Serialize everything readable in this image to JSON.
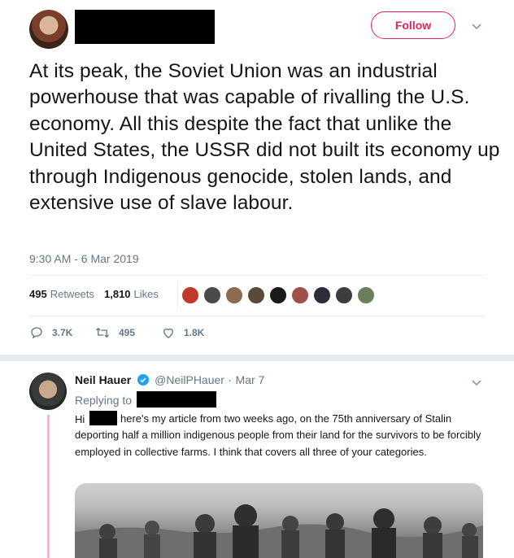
{
  "header": {
    "follow_label": "Follow",
    "accent_color": "#e0245e"
  },
  "tweet": {
    "text": "At its peak, the Soviet Union was an industrial powerhouse that was capable of rivalling the U.S. economy. All this despite the fact that unlike the United States, the USSR did not built its economy up through Indigenous genocide, stolen lands, and extensive use of slave labour.",
    "timestamp": "9:30 AM - 6 Mar 2019",
    "retweets_count": "495",
    "retweets_label": "Retweets",
    "likes_count": "1,810",
    "likes_label": "Likes",
    "reply_action_count": "3.7K",
    "retweet_action_count": "495",
    "like_action_count": "1.8K"
  },
  "reply": {
    "name": "Neil Hauer",
    "handle": "@NeilPHauer",
    "separator": "·",
    "date": "Mar 7",
    "replying_to_label": "Replying to",
    "greeting": "Hi",
    "body": "here's my article from two weeks ago, on the 75th anniversary of Stalin deporting half a million indigenous people from their land for the survivors to be forcibly employed in collective farms. I think that covers all three of your categories."
  }
}
